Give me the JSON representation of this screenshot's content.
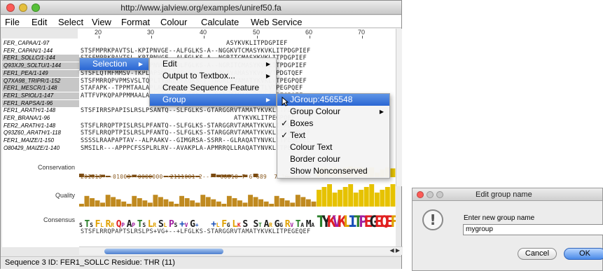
{
  "window": {
    "title": "http://www.jalview.org/examples/uniref50.fa",
    "menus": [
      "File",
      "Edit",
      "Select",
      "View",
      "Format",
      "Colour",
      "Calculate",
      "Web Service"
    ],
    "ruler": [
      "20",
      "30",
      "40",
      "50",
      "60",
      "70"
    ]
  },
  "sequences": [
    {
      "id": "FER_CAPAA/1-97",
      "seq": "                                      ASYKVKLITPDGPIEF",
      "selected": false
    },
    {
      "id": "FER_CAPAN/1-144",
      "seq": "STSFMPRKPAVTSL-KPIPNVGE--ALFGLKS-A--NGGKVTCMASYKVKLITPDGPIEF",
      "selected": false
    },
    {
      "id": "FER1_SOLLC/1-144",
      "seq": "STSFMPRKPAVTSL-KPIPNVGE--ALFGLKS-A--NGRITCMASYKVKLITPDGPIEF",
      "selected": true
    },
    {
      "id": "Q93XJ9_SOLTU/1-144",
      "seq": "STSFMPRKPAVTSL-KPIPNVGE--ALFGLKS-A--NGRITCMASYKVKLITPDGPIEF",
      "selected": true
    },
    {
      "id": "FER1_PEA/1-149",
      "seq": "STSFLQTMFMMSV-TKPLAPSNLLFAPKSG-T--NGRLAVAMASYKVKLVTPDGTQEF",
      "selected": true
    },
    {
      "id": "Q7XA98_TRIPR/1-152",
      "seq": "STSFMRRQPVPMSVSLTQPLTTSNLLFAGKS-T--NGRLAVAMATYKVKLVTPEGPQEF",
      "selected": true
    },
    {
      "id": "FER1_MESCR/1-148",
      "seq": "STAFAPK--TPPMTAALAPLAGKASLFAGSSGG--NGRVTAMAAYKVTLVTPEGPQEF",
      "selected": true
    },
    {
      "id": "FER1_SPIOL/1-147",
      "seq": "ATTFVPKQPAPPMMAALAPLSGKASLFAGSS----NGRVTAMASYKVKLITPEGPQEF",
      "selected": true
    },
    {
      "id": "FER1_RAPSA/1-96",
      "seq": "",
      "selected": true
    },
    {
      "id": "FER1_ARATH/1-148",
      "seq": "STSFIRRSPAPISLRSLPSANTQ--SLFGLKS-GTARGGRVTAMATYKVKLITPEGPQEF",
      "selected": false
    },
    {
      "id": "FER_BRANA/1-96",
      "seq": "                                        ATYKVKLITPEGPQEF",
      "selected": false
    },
    {
      "id": "FER2_ARATH/1-148",
      "seq": "STSFLRRQPTPISLRSLPFANTQ--SLFGLKS-STARGGRVTAMATYKVKLITPEGPQEF",
      "selected": false
    },
    {
      "id": "Q93Z60_ARATH/1-118",
      "seq": "STSFLRRQPTPISLRSLPFANTQ--SLFGLKS-STARGGRVTAMATYKVKLITPEGPQEF",
      "selected": false
    },
    {
      "id": "FER1_MAIZE/1-150",
      "seq": "SSSSLRAAPAPTAV--ALPAAKV--GIMGRSA-SSRR--GLRAQATYNVKLITPEGEVEL",
      "selected": false
    },
    {
      "id": "O80429_MAIZE/1-140",
      "seq": "SMSILR---APPPCFSSPLRLRV--AVAKPLA-APMRRQLLRAQATYNVKLITPEGEVEL",
      "selected": false
    }
  ],
  "annotations": {
    "conservation_label": "Conservation",
    "conservation_string": "201010---01000--0000000--2111001-2-----00010 7 6 689  7 36 7",
    "quality_label": "Quality",
    "consensus_label": "Consensus",
    "consensus_string": "STSFLRRQPAPTSLRSLPS+VG+--+LFGLKS-STARGGRVTAMATYKVKLITPEGEQEF"
  },
  "context_menu": {
    "items": [
      {
        "label": "Selection",
        "submenu": true,
        "highlighted": true
      }
    ]
  },
  "selection_menu": {
    "items": [
      {
        "label": "Edit",
        "submenu": true
      },
      {
        "label": "Output to Textbox...",
        "submenu": true
      },
      {
        "label": "Create Sequence Feature",
        "submenu": false
      },
      {
        "label": "Group",
        "submenu": true,
        "highlighted": true
      }
    ]
  },
  "group_menu": {
    "items": [
      {
        "label": "JGroup:4565548",
        "highlighted": true,
        "checked": false,
        "submenu": false
      },
      {
        "label": "Group Colour",
        "highlighted": false,
        "checked": false,
        "submenu": true
      },
      {
        "label": "Boxes",
        "highlighted": false,
        "checked": true,
        "submenu": false
      },
      {
        "label": "Text",
        "highlighted": false,
        "checked": true,
        "submenu": false
      },
      {
        "label": "Colour Text",
        "highlighted": false,
        "checked": false,
        "submenu": false
      },
      {
        "label": "Border colour",
        "highlighted": false,
        "checked": false,
        "submenu": false
      },
      {
        "label": "Show Nonconserved",
        "highlighted": false,
        "checked": false,
        "submenu": false
      }
    ]
  },
  "status": "Sequence 3 ID: FER1_SOLLC  Residue: THR (11)",
  "dialog": {
    "title": "Edit group name",
    "prompt": "Enter new group name",
    "value": "mygroup",
    "cancel": "Cancel",
    "ok": "OK",
    "icon": "warning-icon"
  },
  "colors": {
    "highlight": "#2a66d3",
    "selection_bg": "#c7c7c7",
    "conservation_brown": "#7a4a10",
    "quality_yellow": "#e6c200"
  }
}
